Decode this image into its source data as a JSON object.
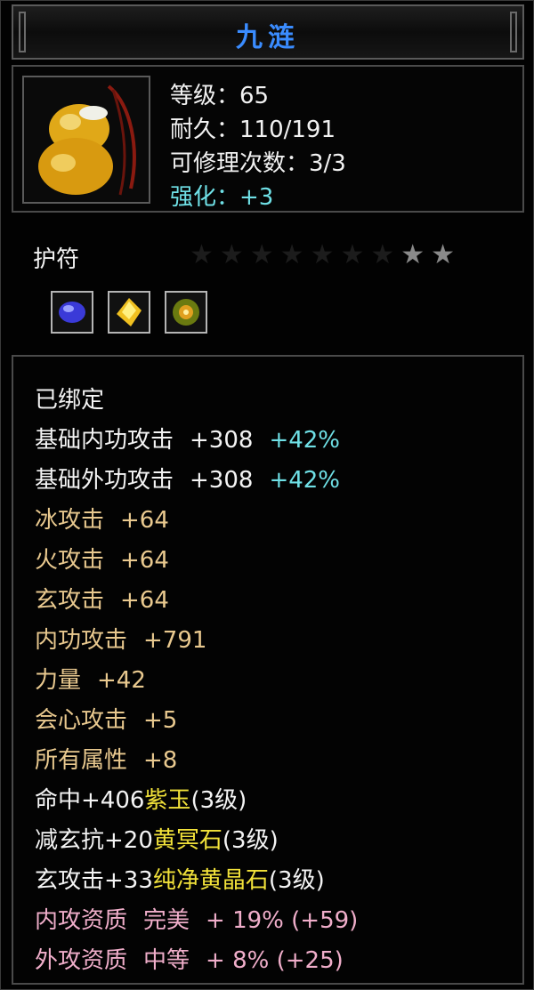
{
  "item": {
    "name": "九涟",
    "level": "等级：65",
    "durability": "耐久：110/191",
    "repairs": "可修理次数：3/3",
    "enhance": "强化：+3",
    "type": "护符",
    "stars_total": 9,
    "stars_lit": 2,
    "icon": "amber-pendant-icon",
    "gems": [
      "purple-gem-icon",
      "yellow-gem-icon",
      "green-gold-gem-icon"
    ]
  },
  "attributes": {
    "bound": "已绑定",
    "base_inner": {
      "label": "基础内功攻击",
      "value": "+308",
      "pct": "+42%"
    },
    "base_outer": {
      "label": "基础外功攻击",
      "value": "+308",
      "pct": "+42%"
    },
    "ice": {
      "label": "冰攻击",
      "value": "+64"
    },
    "fire": {
      "label": "火攻击",
      "value": "+64"
    },
    "xuan": {
      "label": "玄攻击",
      "value": "+64"
    },
    "inner": {
      "label": "内功攻击",
      "value": "+791"
    },
    "strength": {
      "label": "力量",
      "value": "+42"
    },
    "crit": {
      "label": "会心攻击",
      "value": "+5"
    },
    "all": {
      "label": "所有属性",
      "value": "+8"
    },
    "gem1": {
      "text": "命中+406",
      "gem": "紫玉",
      "lvl": "(3级)"
    },
    "gem2": {
      "text": "减玄抗+20",
      "gem": "黄冥石",
      "lvl": "(3级)"
    },
    "gem3": {
      "text": "玄攻击+33",
      "gem": "纯净黄晶石",
      "lvl": "(3级)"
    },
    "q_inner": {
      "label": "内攻资质",
      "grade": "完美",
      "value": "+ 19% (+59)"
    },
    "q_outer": {
      "label": "外攻资质",
      "grade": "中等",
      "value": "+ 8% (+25)"
    }
  },
  "colors": {
    "title": "#3a8cff",
    "cyan": "#6fe0e6",
    "gold": "#e9c98f",
    "pink": "#f0aeca",
    "gem_yellow": "#f2e23a"
  }
}
